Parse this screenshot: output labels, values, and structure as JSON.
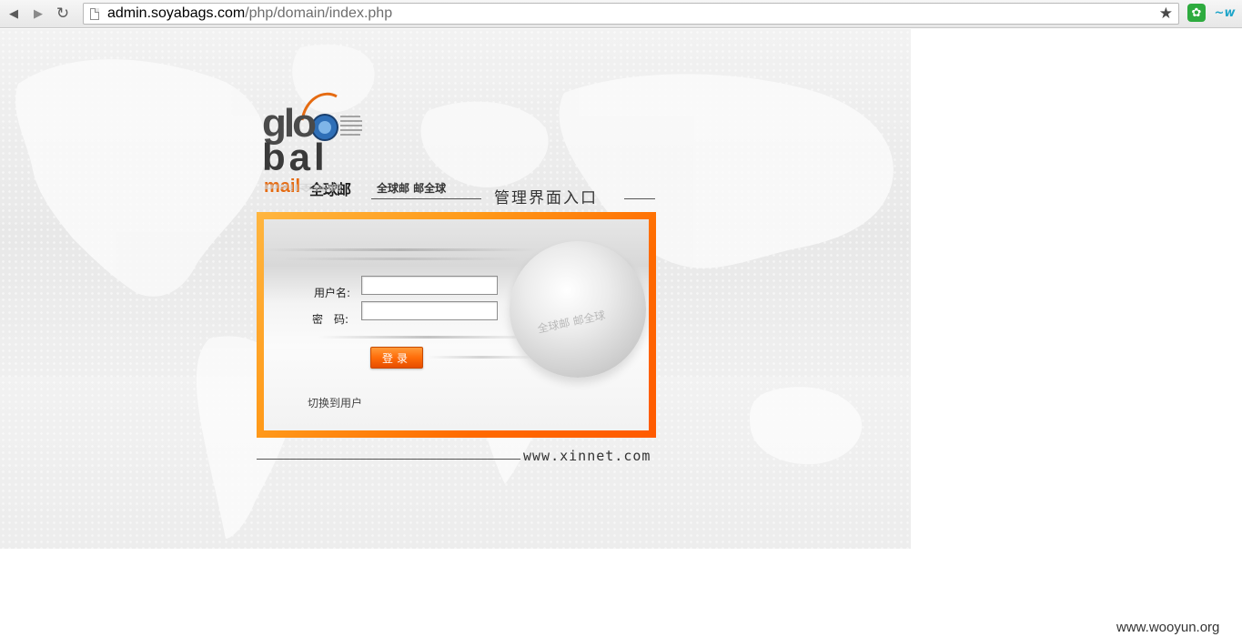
{
  "browser": {
    "url_host": "admin.soyabags.com",
    "url_path": "/php/domain/index.php",
    "icons": {
      "back": "back-arrow-icon",
      "forward": "forward-arrow-icon",
      "reload": "reload-icon",
      "page": "page-icon",
      "bookmark": "bookmark-star-icon",
      "extension1": "extension-icon",
      "extension2": "extension-icon"
    }
  },
  "logo": {
    "word_top": "glo",
    "word_bottom": "bal",
    "mail": "mail",
    "cn_name": "全球邮",
    "reflection": "mail全球邮"
  },
  "header": {
    "slogan": "全球邮 邮全球",
    "title": "管理界面入口"
  },
  "login": {
    "username_label": "用户名:",
    "password_label": "密　码:",
    "username_value": "",
    "password_value": "",
    "submit_label": "登录",
    "switch_link": "切换到用户",
    "globe_text": "全球邮 邮全球"
  },
  "footer": {
    "site": "www.xinnet.com"
  },
  "watermark": "www.wooyun.org",
  "colors": {
    "accent_orange": "#ff6a00",
    "frame_light": "#ffb640",
    "background": "#ececec"
  }
}
